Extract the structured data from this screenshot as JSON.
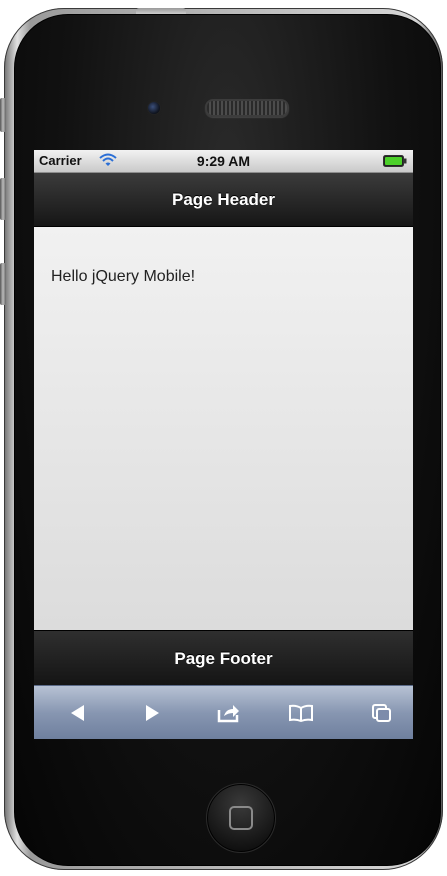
{
  "status_bar": {
    "carrier": "Carrier",
    "time": "9:29 AM",
    "wifi_icon": "wifi-icon",
    "battery_icon": "battery-icon",
    "battery_color": "#4cd02a"
  },
  "header": {
    "title": "Page Header"
  },
  "content": {
    "text": "Hello jQuery Mobile!"
  },
  "footer": {
    "title": "Page Footer"
  },
  "toolbar": {
    "buttons": [
      {
        "icon": "back-arrow-icon"
      },
      {
        "icon": "forward-arrow-icon"
      },
      {
        "icon": "share-icon"
      },
      {
        "icon": "bookmarks-icon"
      },
      {
        "icon": "tabs-icon"
      }
    ]
  },
  "colors": {
    "bar_dark": "#1c1c1c",
    "content_bg": "#e6e6e6",
    "toolbar_blue": "#8796b1"
  }
}
